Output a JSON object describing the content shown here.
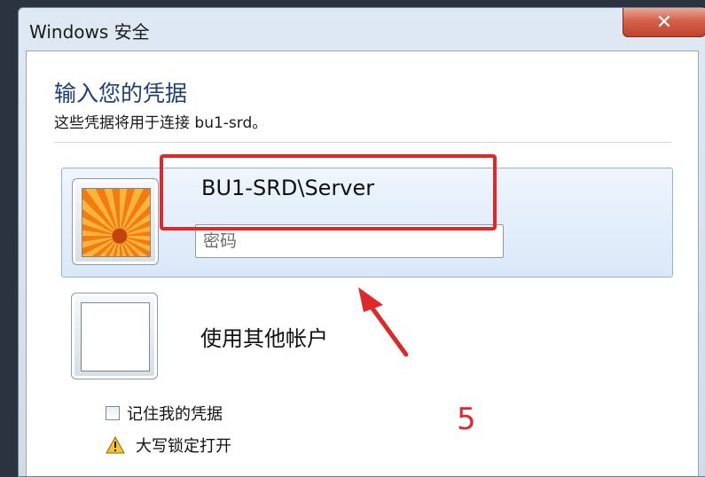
{
  "window": {
    "title": "Windows 安全",
    "close_label": "✕"
  },
  "dialog": {
    "heading": "输入您的凭据",
    "subheading": "这些凭据将用于连接 bu1-srd。"
  },
  "credential": {
    "username": "BU1-SRD\\Server",
    "password_placeholder": "密码",
    "password_value": ""
  },
  "other_account": {
    "label": "使用其他帐户"
  },
  "options": {
    "remember_label": "记住我的凭据",
    "remember_checked": false,
    "capslock_warning": "大写锁定打开"
  },
  "annotation": {
    "step_number": "5",
    "color": "#e0282b"
  },
  "icons": {
    "close": "close-icon",
    "warning": "warning-icon",
    "avatar": "flower-avatar-icon",
    "arrow": "annotation-arrow-icon"
  },
  "colors": {
    "heading": "#1f3f79",
    "close_button": "#c1432c",
    "tile_border": "#8fb3da"
  }
}
